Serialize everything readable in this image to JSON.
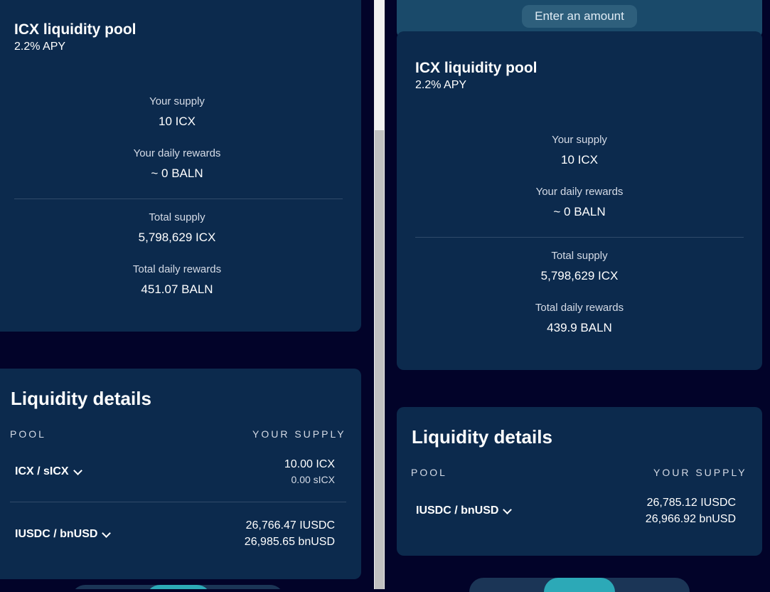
{
  "left": {
    "pool": {
      "title": "ICX liquidity pool",
      "apy": "2.2% APY",
      "your_supply_label": "Your supply",
      "your_supply_value": "10 ICX",
      "your_daily_rewards_label": "Your daily rewards",
      "your_daily_rewards_value": "~ 0 BALN",
      "total_supply_label": "Total supply",
      "total_supply_value": "5,798,629 ICX",
      "total_daily_rewards_label": "Total daily rewards",
      "total_daily_rewards_value": "451.07 BALN"
    },
    "liquidity": {
      "title": "Liquidity details",
      "col_pool": "POOL",
      "col_supply": "YOUR SUPPLY",
      "rows": [
        {
          "pair": "ICX / sICX",
          "amount1": "10.00 ICX",
          "amount2": "0.00 sICX"
        },
        {
          "pair": "IUSDC / bnUSD",
          "amount1": "26,766.47 IUSDC",
          "amount2": "26,985.65 bnUSD"
        }
      ]
    }
  },
  "right": {
    "enter_amount_label": "Enter an amount",
    "pool": {
      "title": "ICX liquidity pool",
      "apy": "2.2% APY",
      "your_supply_label": "Your supply",
      "your_supply_value": "10 ICX",
      "your_daily_rewards_label": "Your daily rewards",
      "your_daily_rewards_value": "~ 0 BALN",
      "total_supply_label": "Total supply",
      "total_supply_value": "5,798,629 ICX",
      "total_daily_rewards_label": "Total daily rewards",
      "total_daily_rewards_value": "439.9 BALN"
    },
    "liquidity": {
      "title": "Liquidity details",
      "col_pool": "POOL",
      "col_supply": "YOUR SUPPLY",
      "rows": [
        {
          "pair": "IUSDC / bnUSD",
          "amount1": "26,785.12 IUSDC",
          "amount2": "26,966.92 bnUSD"
        }
      ]
    }
  },
  "colors": {
    "background": "#020329",
    "card": "#0c2a4d",
    "accent": "#2ca9b7"
  }
}
